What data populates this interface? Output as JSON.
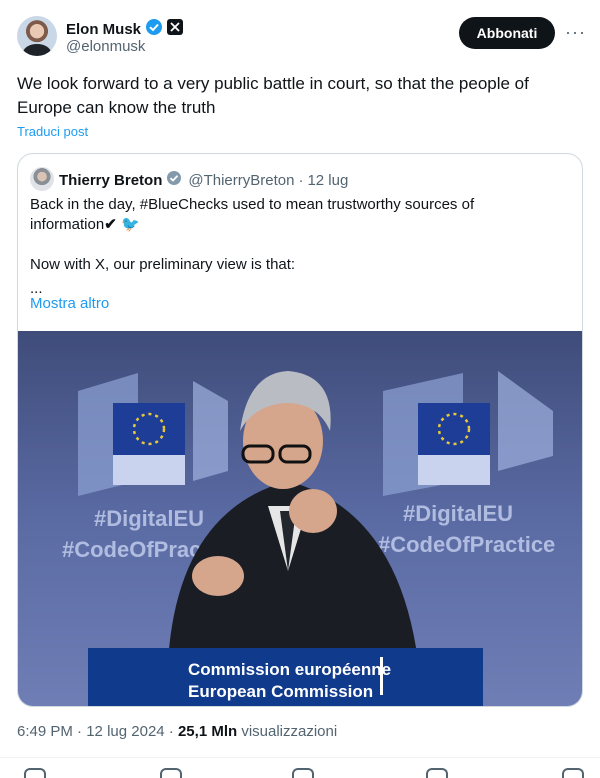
{
  "tweet": {
    "author_name": "Elon Musk",
    "author_handle": "@elonmusk",
    "subscribe_label": "Abbonati",
    "more_label": "···",
    "text": "We look forward to a very public battle in court, so that the people of Europe can know the truth",
    "translate_label": "Traduci post",
    "time": "6:49 PM",
    "date": "12 lug 2024",
    "views_count": "25,1 Mln",
    "views_label": "visualizzazioni"
  },
  "quote": {
    "author_name": "Thierry Breton",
    "author_handle": "@ThierryBreton",
    "date": "12 lug",
    "line1": "Back in the day, #BlueChecks used to mean trustworthy sources of",
    "line2": "information",
    "line3": "Now with X, our preliminary view is that:",
    "line4": "...",
    "show_more": "Mostra altro"
  },
  "photo": {
    "hashtag1": "#DigitalEU",
    "hashtag2": "#CodeOfPractice",
    "podium_line1": "Commission européenne",
    "podium_line2": "European Commission",
    "colors": {
      "background": "#4b5a8c",
      "podium": "#103a8c",
      "eu_flag": "#1e3d96"
    }
  }
}
